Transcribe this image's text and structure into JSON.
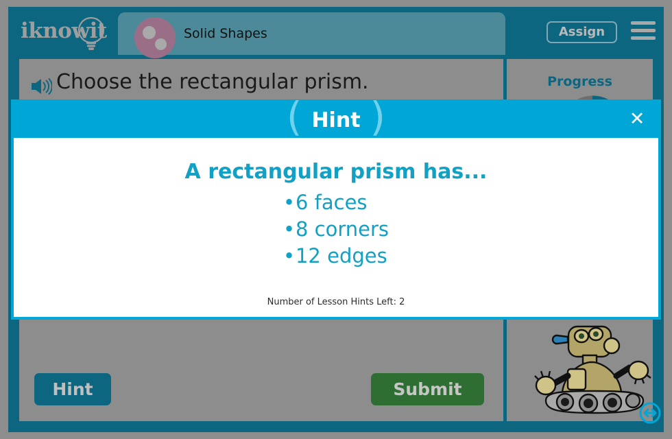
{
  "header": {
    "logo_text": "iknowit",
    "logo_icon": "lightbulb-icon",
    "lesson_title": "Solid Shapes",
    "lesson_badge_icon": "solid-shapes-icon",
    "assign_label": "Assign",
    "menu_icon": "hamburger-menu-icon"
  },
  "question": {
    "speaker_icon": "speaker-audio-icon",
    "text": "Choose the rectangular prism."
  },
  "progress": {
    "label": "Progress",
    "ring_percent": 25,
    "ring_track_color": "#6e6e6e",
    "ring_fill_color": "#0d6680"
  },
  "mascot": {
    "name": "robot-mascot",
    "resize_icon": "resize-horizontal-icon"
  },
  "actions": {
    "hint_label": "Hint",
    "submit_label": "Submit",
    "hint_color": "#0d6680",
    "submit_color": "#2f6e33"
  },
  "hint_modal": {
    "title": "Hint",
    "left_paren": "(",
    "right_paren": ")",
    "close_icon": "✕",
    "heading": "A rectangular prism has...",
    "bullet_char": "•",
    "items": [
      "6 faces",
      "8 corners",
      "12 edges"
    ],
    "hints_left_text": "Number of Lesson Hints Left: 2",
    "accent_color": "#00a6d6",
    "text_color": "#12a0c4"
  }
}
